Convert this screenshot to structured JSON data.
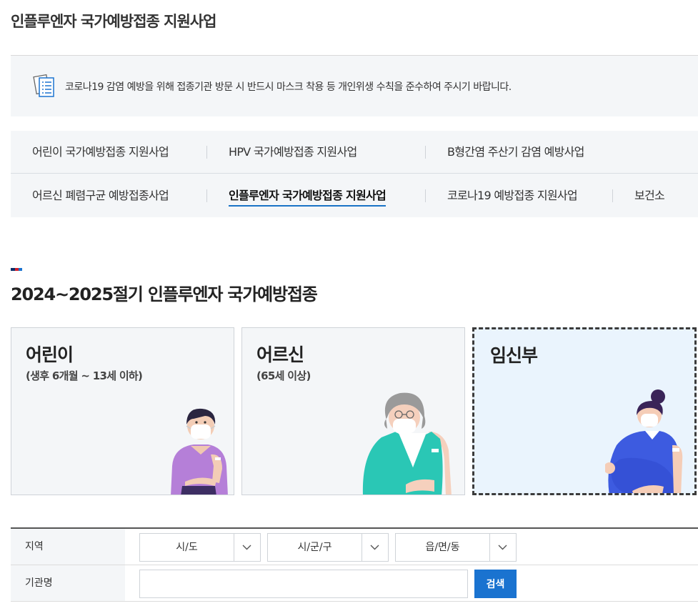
{
  "page": {
    "title": "인플루엔자 국가예방접종 지원사업"
  },
  "notice": {
    "icon": "document-list-icon",
    "text": "코로나19 감염 예방을 위해 접종기관 방문 시 반드시 마스크 착용 등 개인위생 수칙을 준수하여 주시기 바랍니다."
  },
  "category_nav": {
    "row1": [
      "어린이 국가예방접종 지원사업",
      "HPV 국가예방접종 지원사업",
      "B형간염 주산기 감염 예방사업"
    ],
    "row2": [
      "어르신 폐렴구균 예방접종사업",
      "인플루엔자 국가예방접종 지원사업",
      "코로나19 예방접종 지원사업",
      "보건소"
    ],
    "active": "인플루엔자 국가예방접종 지원사업"
  },
  "section": {
    "title": "2024~2025절기 인플루엔자 국가예방접종",
    "mark_colors": [
      "#0b2f6b",
      "#d21f2b",
      "#1a73d0"
    ]
  },
  "cards": [
    {
      "title": "어린이",
      "subtitle": "(생후 6개월 ~ 13세 이하)",
      "illustration": "child-vaccinated-illustration"
    },
    {
      "title": "어르신",
      "subtitle": "(65세 이상)",
      "illustration": "elderly-vaccinated-illustration"
    },
    {
      "title": "임신부",
      "subtitle": "",
      "illustration": "pregnant-woman-vaccinated-illustration",
      "selected": true
    }
  ],
  "search": {
    "region_label": "지역",
    "sido": "시/도",
    "sigungu": "시/군/구",
    "dong": "읍/면/동",
    "org_label": "기관명",
    "org_value": "",
    "button": "검색"
  },
  "colors": {
    "accent": "#1a73d0",
    "panel_bg": "#f4f6f8",
    "selected_card_bg": "#eaf4fd"
  }
}
